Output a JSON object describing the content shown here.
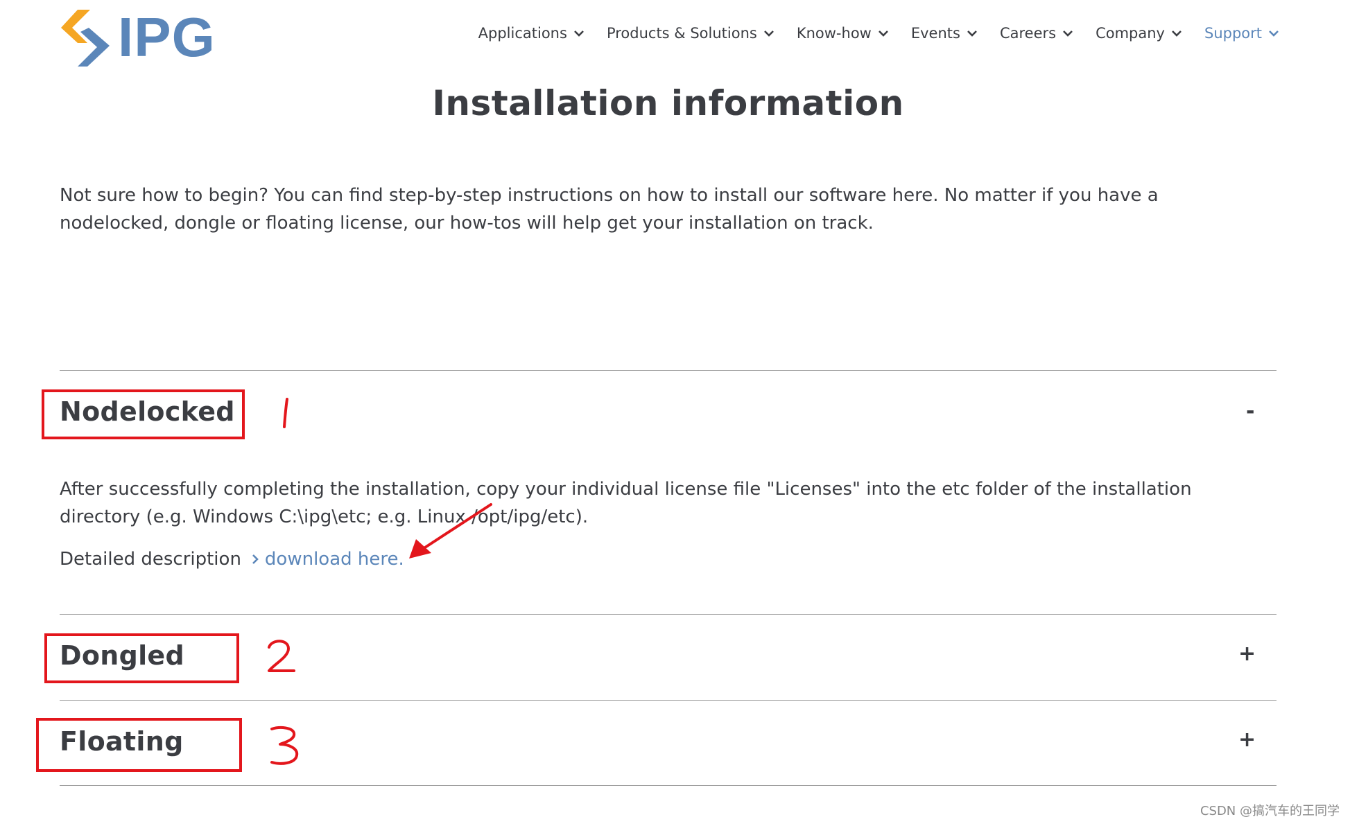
{
  "header": {
    "logo_text": "IPG",
    "nav": [
      {
        "label": "Applications"
      },
      {
        "label": "Products & Solutions"
      },
      {
        "label": "Know-how"
      },
      {
        "label": "Events"
      },
      {
        "label": "Careers"
      },
      {
        "label": "Company"
      },
      {
        "label": "Support",
        "active": true
      }
    ]
  },
  "main": {
    "title": "Installation information",
    "intro": "Not sure how to begin? You can find step-by-step instructions on how to install our software here. No matter if you have a nodelocked, dongle or floating license, our how-tos will help get your installation on track.",
    "sections": [
      {
        "title": "Nodelocked",
        "toggle": "-",
        "expanded": true,
        "body": "After successfully completing the installation, copy your individual license file \"Licenses\" into the etc folder of the installation directory (e.g. Windows C:\\ipg\\etc; e.g. Linux /opt/ipg/etc).",
        "detail_label": "Detailed description",
        "detail_link": "download here."
      },
      {
        "title": "Dongled",
        "toggle": "+",
        "expanded": false
      },
      {
        "title": "Floating",
        "toggle": "+",
        "expanded": false
      }
    ]
  },
  "annotations": {
    "numbers": [
      "1",
      "2",
      "3"
    ],
    "color": "#e3161c"
  },
  "colors": {
    "brand_blue": "#5b86b9",
    "brand_orange": "#f5a623",
    "text": "#3b3d42"
  },
  "watermark": "CSDN @搞汽车的王同学"
}
